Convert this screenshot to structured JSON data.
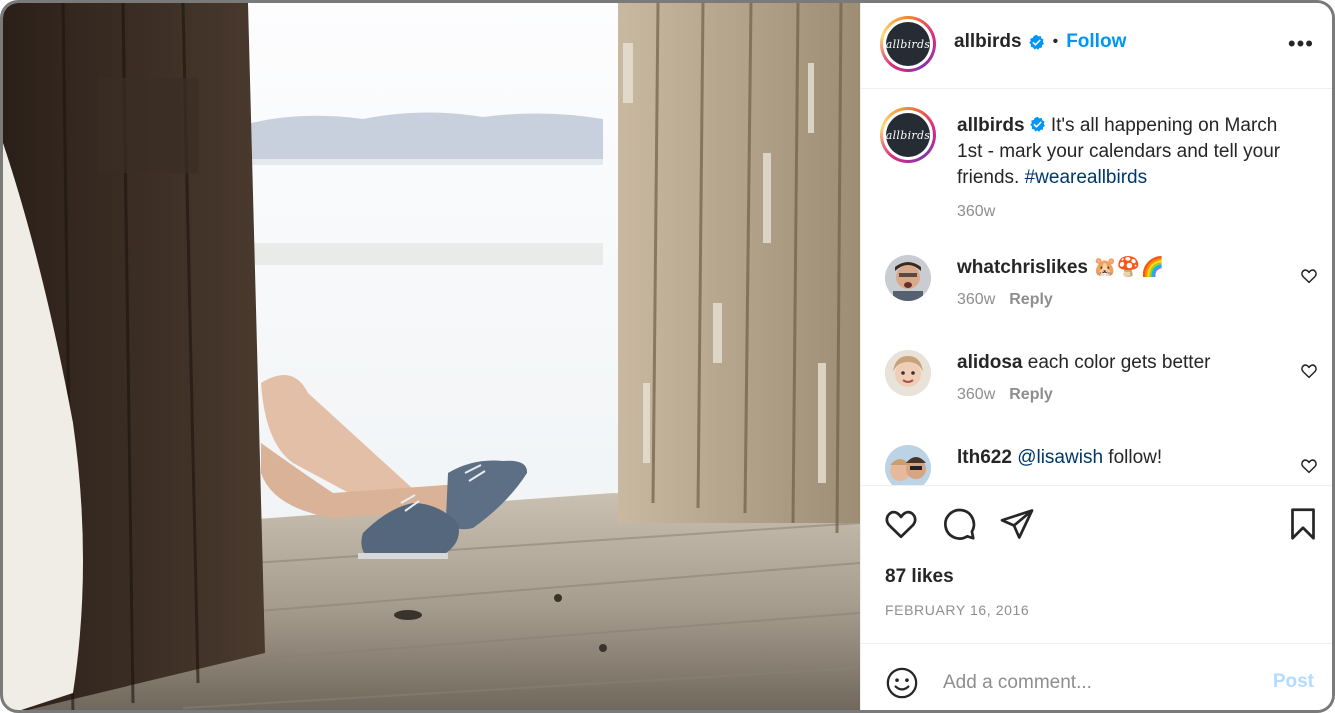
{
  "post": {
    "image_alt": "Legs wearing grey wool sneakers in a barn doorway",
    "account": {
      "username": "allbirds",
      "avatar_text": "allbirds",
      "verified_icon": "verified-badge-icon",
      "separator": "•",
      "follow_label": "Follow",
      "more_icon": "•••"
    },
    "caption": {
      "username": "allbirds",
      "text": " It's all happening on March 1st - mark your calendars and tell your friends. ",
      "hashtag": "#weareallbirds",
      "time": "360w"
    },
    "comments": [
      {
        "username": "whatchrislikes",
        "text": " 🐹🍄🌈",
        "time": "360w",
        "reply_label": "Reply"
      },
      {
        "username": "alidosa",
        "text": " each color gets better",
        "time": "360w",
        "reply_label": "Reply"
      },
      {
        "username": "lth622",
        "mention": "@lisawish",
        "text": " follow!"
      }
    ],
    "likes": "87 likes",
    "date": "FEBRUARY 16, 2016",
    "add_comment": {
      "placeholder": "Add a comment...",
      "post_label": "Post"
    }
  },
  "colors": {
    "accent": "#0095f6",
    "link": "#00376b",
    "muted": "#8e8e8e",
    "post_disabled": "#b3dbff"
  }
}
